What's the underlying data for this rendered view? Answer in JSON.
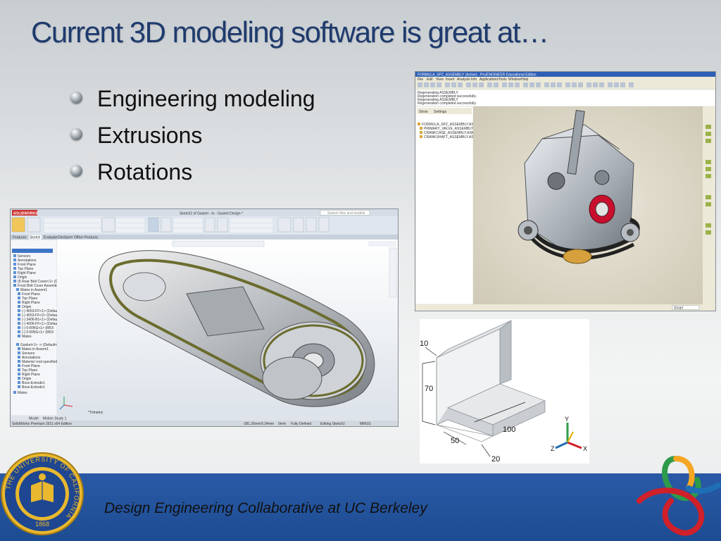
{
  "slide": {
    "title": "Current 3D modeling software is great at…",
    "bullets": [
      "Engineering modeling",
      "Extrusions",
      "Rotations"
    ],
    "footer": "Design Engineering Collaborative at UC Berkeley"
  },
  "solidworks": {
    "app_name": "SOLIDWORKS",
    "title_bar": "Sketch2 of Gasket - In - Gasket Design *",
    "search_placeholder": "Search files and models",
    "tabs": [
      "Features",
      "Sketch",
      "Evaluate",
      "DimXpert",
      "Office Products"
    ],
    "tree_items": [
      "Sensors",
      "Annotations",
      "Front Plane",
      "Top Plane",
      "Right Plane",
      "Origin",
      "(f) Rear Belt Cover<1> (Def",
      "Front Belt Cover Assembly",
      "Mates in Assem1",
      "Front Plane",
      "Top Plane",
      "Right Plane",
      "Origin",
      "(-) 4053-FF<1> (Defau",
      "(-) 4053-FF<2> (Defau",
      "(-) 3406-B1<1> (Defau",
      "(-) 4006-FF<1> (Defau",
      "(-) 0-RING<1> (M5X",
      "(-) 0-RING<1> (M5X",
      "Mates",
      "Gasket<1> -> (Default<D",
      "Mates in Assem1",
      "Sensors",
      "Annotations",
      "Material <not specified>",
      "Front Plane",
      "Top Plane",
      "Right Plane",
      "Origin",
      "Boss-Extrude1",
      "Boss-Extrude1",
      "Mates"
    ],
    "bottom_tabs": [
      "Model",
      "Motion Study 1"
    ],
    "view_label": "*Trimetric",
    "status": {
      "edition": "SolidWorks Premium 2011 x64 Edition",
      "x": "-281.26mm",
      "y": "8.34mm",
      "z": "0mm",
      "state": "Fully Defined",
      "editing": "Editing Sketch2",
      "units": "MMGS"
    }
  },
  "proe": {
    "title_bar": "FORMULA_SPZ_ASSEMBLY (Active) - Pro/ENGINEER Educational Edition",
    "menu": [
      "File",
      "Edit",
      "View",
      "Insert",
      "Analysis",
      "Info",
      "Applications",
      "Tools",
      "Window",
      "Help"
    ],
    "messages": [
      "Regenerating ASSEMBLY",
      "Regeneration completed successfully.",
      "Regenerating ASSEMBLY",
      "Regeneration completed successfully."
    ],
    "panel_tabs": [
      "Show",
      "Settings"
    ],
    "tree_items": [
      "FORMULA_SPZ_ASSEMBLY.ASM",
      "PRIMARY_VALVE_ASSEMBLY.ASM",
      "CRANKCASE_ASSEMBLY.ASM",
      "CRANKSHAFT_ASSEMBLY.ASM"
    ],
    "status_filter": "Smart"
  },
  "dimensions": {
    "d10": "10",
    "d70": "70",
    "d50": "50",
    "d100": "100",
    "d20": "20",
    "axis_x": "X",
    "axis_y": "Y",
    "axis_z": "Z"
  },
  "seal": {
    "text": "THE UNIVERSITY OF CALIFORNIA",
    "year": "1868"
  },
  "colors": {
    "title": "#1f3b6e",
    "footer": "#2a5aa6",
    "sw_ribbon": "#dfe6ef",
    "proe_viewport": "#dcd7c6",
    "logo_red": "#d0202a",
    "logo_green": "#2e9b4a",
    "logo_orange": "#f5a623",
    "logo_blue": "#1f6fb5"
  }
}
